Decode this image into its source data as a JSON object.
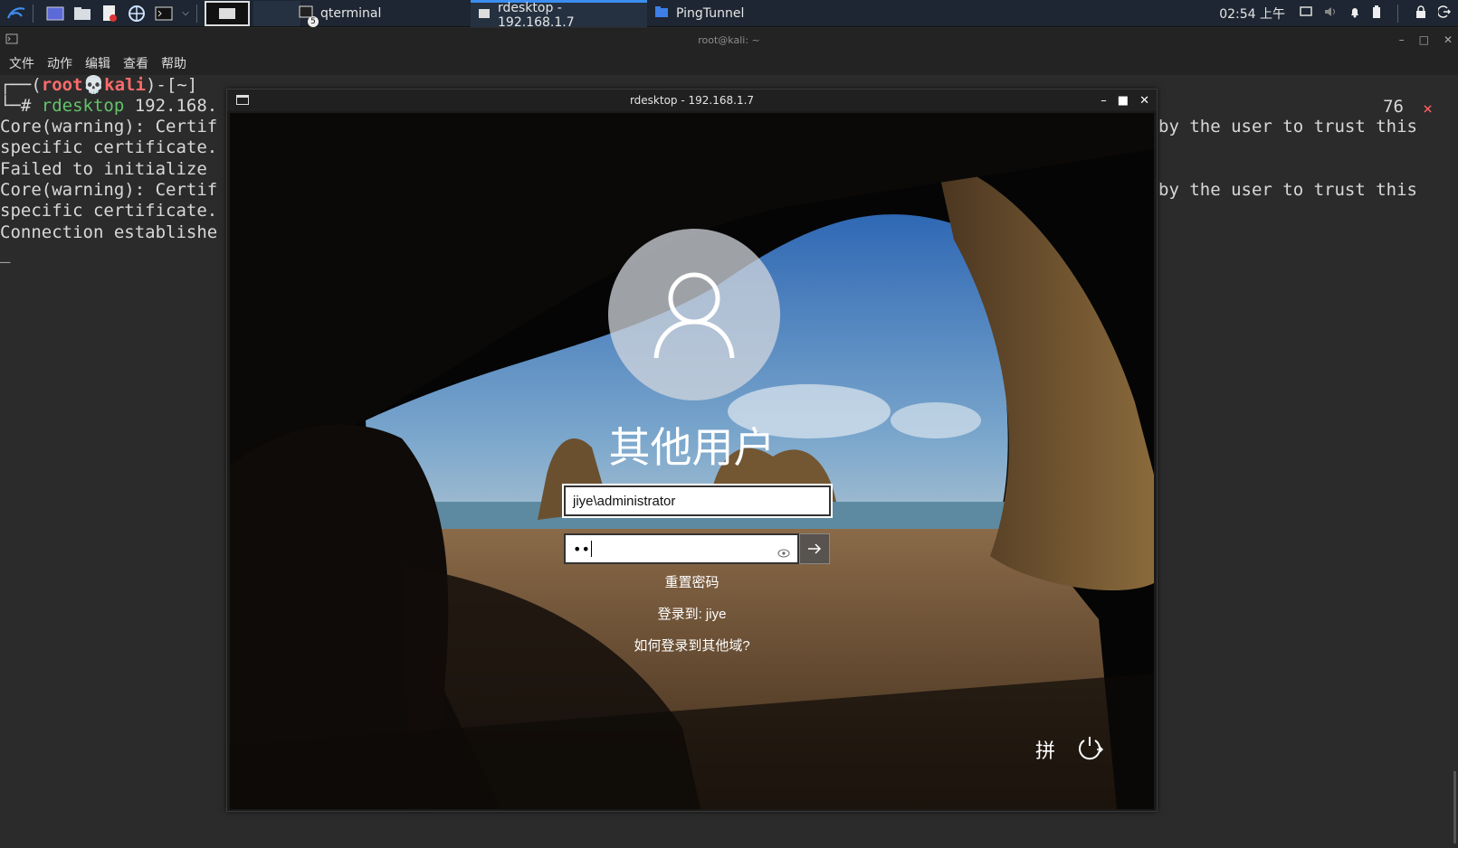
{
  "taskbar": {
    "tasks": [
      {
        "label": "qterminal",
        "badge": "5"
      },
      {
        "label": "rdesktop - 192.168.1.7"
      },
      {
        "label": "PingTunnel"
      }
    ],
    "clock": "02:54 上午"
  },
  "terminal": {
    "title": "root@kali: ~",
    "menu": [
      "文件",
      "动作",
      "编辑",
      "查看",
      "帮助"
    ],
    "prompt": {
      "open": "┌──(",
      "user": "root💀kali",
      "close": ")-[~]",
      "hash": "└─# ",
      "command": "rdesktop",
      "args": " 192.168."
    },
    "lines": [
      "Core(warning): Certif",
      "specific certificate.",
      "Failed to initialize",
      "Core(warning): Certif",
      "specific certificate.",
      "Connection establishe"
    ],
    "right_lines": [
      "by the user to trust this",
      "by the user to trust this"
    ],
    "right_number": "76",
    "right_close": "×",
    "cursor": "_"
  },
  "rdp": {
    "title": "rdesktop - 192.168.1.7",
    "login": {
      "user_name": "其他用户",
      "username_value": "jiye\\administrator",
      "password_value": "••",
      "reset_password": "重置密码",
      "sign_in_to": "登录到: jiye",
      "other_domain": "如何登录到其他域?",
      "ime_indicator": "拼"
    }
  },
  "colors": {
    "taskbar_bg": "#1d2632",
    "terminal_bg": "#2b2b2b",
    "prompt_user": "#ff6b6b",
    "prompt_cmd": "#63c46a",
    "accent": "#3b8ef0"
  }
}
